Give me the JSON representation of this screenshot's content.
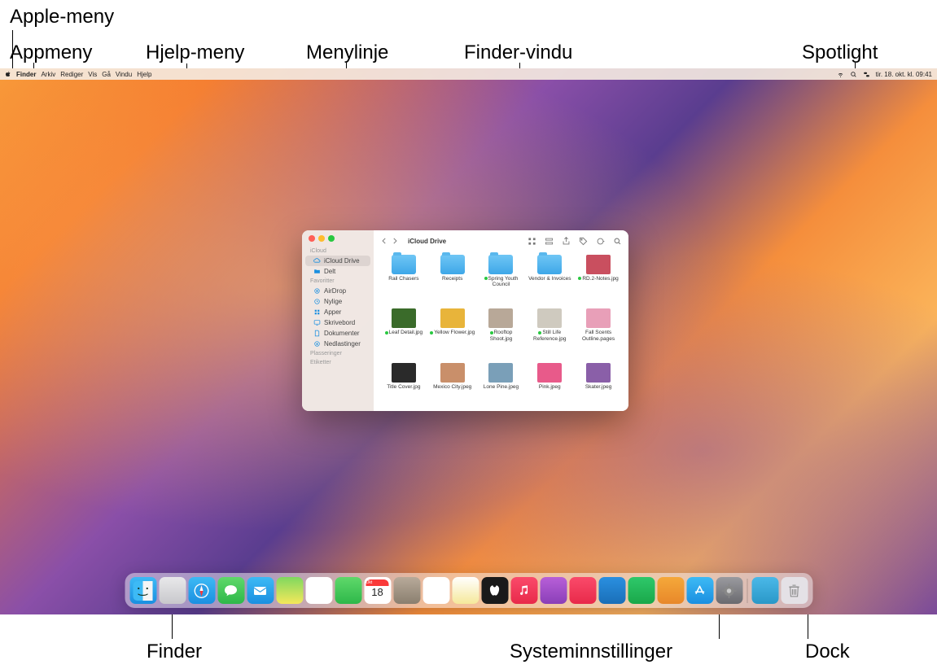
{
  "callouts": {
    "apple_menu": "Apple-meny",
    "app_menu": "Appmeny",
    "help_menu": "Hjelp-meny",
    "menubar": "Menylinje",
    "finder_window": "Finder-vindu",
    "spotlight": "Spotlight",
    "finder": "Finder",
    "system_settings": "Systeminnstillinger",
    "dock": "Dock"
  },
  "menubar": {
    "app": "Finder",
    "items": [
      "Arkiv",
      "Rediger",
      "Vis",
      "Gå",
      "Vindu",
      "Hjelp"
    ],
    "datetime": "tir. 18. okt. kl. 09:41"
  },
  "finder": {
    "title": "iCloud Drive",
    "sidebar": {
      "sections": [
        {
          "header": "iCloud",
          "items": [
            {
              "label": "iCloud Drive",
              "icon": "cloud",
              "selected": true
            },
            {
              "label": "Delt",
              "icon": "folder-shared",
              "selected": false
            }
          ]
        },
        {
          "header": "Favoritter",
          "items": [
            {
              "label": "AirDrop",
              "icon": "airdrop"
            },
            {
              "label": "Nylige",
              "icon": "clock"
            },
            {
              "label": "Apper",
              "icon": "apps"
            },
            {
              "label": "Skrivebord",
              "icon": "desktop"
            },
            {
              "label": "Dokumenter",
              "icon": "doc"
            },
            {
              "label": "Nedlastinger",
              "icon": "download"
            }
          ]
        },
        {
          "header": "Plasseringer",
          "items": []
        },
        {
          "header": "Etiketter",
          "items": []
        }
      ]
    },
    "files": [
      {
        "name": "Rail Chasers",
        "type": "folder"
      },
      {
        "name": "Receipts",
        "type": "folder"
      },
      {
        "name": "Spring Youth Council",
        "type": "folder",
        "sync": true
      },
      {
        "name": "Vendor & Invoices",
        "type": "folder"
      },
      {
        "name": "RD.2-Notes.jpg",
        "type": "image",
        "sync": true,
        "bg": "#c94f5f"
      },
      {
        "name": "Leaf Detail.jpg",
        "type": "image",
        "sync": true,
        "bg": "#3a6b2a"
      },
      {
        "name": "Yellow Flower.jpg",
        "type": "image",
        "sync": true,
        "bg": "#e8b43a"
      },
      {
        "name": "Rooftop Shoot.jpg",
        "type": "image",
        "sync": true,
        "bg": "#b8a898"
      },
      {
        "name": "Still Life Reference.jpg",
        "type": "image",
        "sync": true,
        "bg": "#cfcabf"
      },
      {
        "name": "Fall Scents Outline.pages",
        "type": "doc",
        "bg": "#e89fb8"
      },
      {
        "name": "Title Cover.jpg",
        "type": "image",
        "bg": "#2a2a2a"
      },
      {
        "name": "Mexico City.jpeg",
        "type": "image",
        "bg": "#c98f6a"
      },
      {
        "name": "Lone Pine.jpeg",
        "type": "image",
        "bg": "#7a9fb8"
      },
      {
        "name": "Pink.jpeg",
        "type": "image",
        "bg": "#e85a8a"
      },
      {
        "name": "Skater.jpeg",
        "type": "image",
        "bg": "#8a5fa8"
      }
    ]
  },
  "dock": {
    "items": [
      {
        "name": "finder",
        "bg": "linear-gradient(#3dbaf5,#1a8fe0)"
      },
      {
        "name": "launchpad",
        "bg": "linear-gradient(#e8e8ea,#c8c8cc)"
      },
      {
        "name": "safari",
        "bg": "linear-gradient(#3dbaf5,#1a8fe0)"
      },
      {
        "name": "messages",
        "bg": "linear-gradient(#5fd86a,#2eb84a)"
      },
      {
        "name": "mail",
        "bg": "linear-gradient(#3dbaf5,#1a8fe0)"
      },
      {
        "name": "maps",
        "bg": "linear-gradient(#7fd85f,#f5e85a)"
      },
      {
        "name": "photos",
        "bg": "#fff"
      },
      {
        "name": "facetime",
        "bg": "linear-gradient(#5fd86a,#2eb84a)"
      },
      {
        "name": "calendar",
        "bg": "#fff",
        "text": "18",
        "badge": "Okt"
      },
      {
        "name": "contacts",
        "bg": "linear-gradient(#b8aa9a,#8a7f6f)"
      },
      {
        "name": "reminders",
        "bg": "#fff"
      },
      {
        "name": "notes",
        "bg": "linear-gradient(#fff,#f5e89a)"
      },
      {
        "name": "tv",
        "bg": "#1a1a1a"
      },
      {
        "name": "music",
        "bg": "linear-gradient(#fa4a6a,#e82a4a)"
      },
      {
        "name": "podcasts",
        "bg": "linear-gradient(#b85fd8,#8a3fb8)"
      },
      {
        "name": "news",
        "bg": "linear-gradient(#fa4a6a,#e82a4a)"
      },
      {
        "name": "keynote",
        "bg": "linear-gradient(#2a8fe0,#1a6fb8)"
      },
      {
        "name": "numbers",
        "bg": "linear-gradient(#2ec86a,#1aa84a)"
      },
      {
        "name": "pages",
        "bg": "linear-gradient(#f5a83a,#e8882a)"
      },
      {
        "name": "appstore",
        "bg": "linear-gradient(#3dbaf5,#1a8fe0)"
      },
      {
        "name": "system-settings",
        "bg": "linear-gradient(#9a9a9f,#6a6a6f)"
      }
    ],
    "extras": [
      {
        "name": "downloads",
        "bg": "linear-gradient(#4ab8e8,#2a98c8)"
      },
      {
        "name": "trash",
        "bg": "rgba(230,230,235,0.9)"
      }
    ]
  }
}
